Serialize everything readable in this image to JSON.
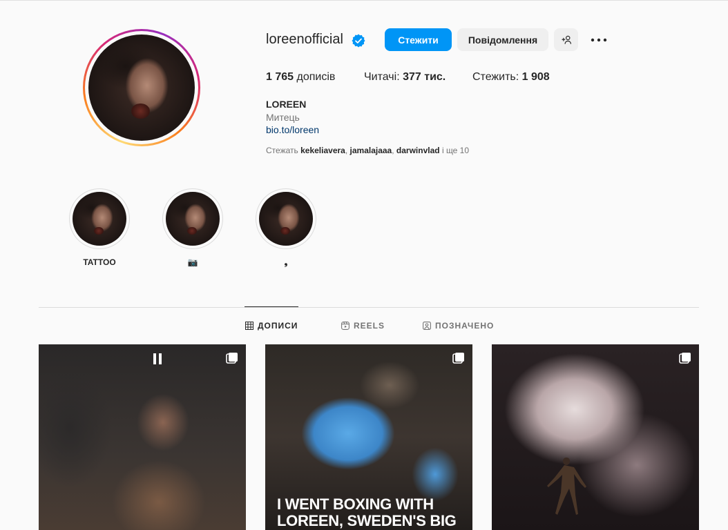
{
  "profile": {
    "username": "loreenofficial",
    "follow_label": "Стежити",
    "message_label": "Повідомлення",
    "add_user_icon": "+8",
    "more_icon": "•••",
    "stats": {
      "posts_count": "1 765",
      "posts_label": "дописів",
      "followers_label": "Читачі:",
      "followers_count": "377 тис.",
      "following_label": "Стежить:",
      "following_count": "1 908"
    },
    "full_name": "LOREEN",
    "category": "Митець",
    "link": "bio.to/loreen",
    "followed_by_prefix": "Стежать",
    "followed_by_1": "kekeliavera",
    "followed_by_2": "jamalajaaa",
    "followed_by_3": "darwinvlad",
    "followed_by_suffix": "і ще 10"
  },
  "highlights": [
    {
      "label": "TATTOO"
    },
    {
      "label": "📷"
    },
    {
      "label": "❟"
    }
  ],
  "tabs": {
    "posts": "ДОПИСИ",
    "reels": "REELS",
    "tagged": "ПОЗНАЧЕНО"
  },
  "posts": [
    {
      "type": "reel"
    },
    {
      "type": "carousel",
      "caption": "I WENT BOXING WITH LOREEN, SWEDEN'S BIG"
    },
    {
      "type": "carousel"
    }
  ],
  "colors": {
    "accent": "#0095f6",
    "secondary_button": "#efefef",
    "link": "#00376b",
    "muted_text": "#737373"
  }
}
